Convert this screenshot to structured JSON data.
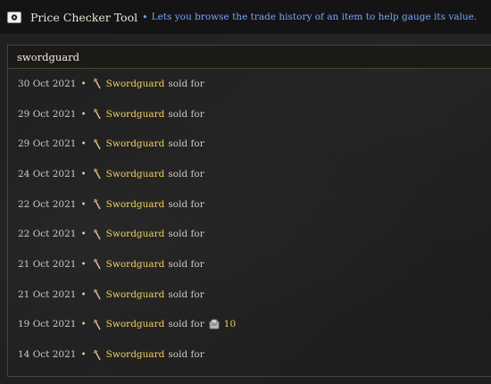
{
  "header": {
    "title": "Price Checker Tool",
    "bullet": "•",
    "subtitle": "Lets you browse the trade history of an item to help gauge its value.",
    "icon": "cash-icon"
  },
  "search": {
    "value": "swordguard"
  },
  "colors": {
    "item_name": "#f0d060",
    "subtitle": "#74a6ff",
    "panel_border": "#4b4538"
  },
  "sales": [
    {
      "date": "30 Oct 2021",
      "sep": "•",
      "item": "Swordguard",
      "sold_text": "sold for",
      "price": ""
    },
    {
      "date": "29 Oct 2021",
      "sep": "•",
      "item": "Swordguard",
      "sold_text": "sold for",
      "price": ""
    },
    {
      "date": "29 Oct 2021",
      "sep": "•",
      "item": "Swordguard",
      "sold_text": "sold for",
      "price": ""
    },
    {
      "date": "24 Oct 2021",
      "sep": "•",
      "item": "Swordguard",
      "sold_text": "sold for",
      "price": ""
    },
    {
      "date": "22 Oct 2021",
      "sep": "•",
      "item": "Swordguard",
      "sold_text": "sold for",
      "price": ""
    },
    {
      "date": "22 Oct 2021",
      "sep": "•",
      "item": "Swordguard",
      "sold_text": "sold for",
      "price": ""
    },
    {
      "date": "21 Oct 2021",
      "sep": "•",
      "item": "Swordguard",
      "sold_text": "sold for",
      "price": ""
    },
    {
      "date": "21 Oct 2021",
      "sep": "•",
      "item": "Swordguard",
      "sold_text": "sold for",
      "price": ""
    },
    {
      "date": "19 Oct 2021",
      "sep": "•",
      "item": "Swordguard",
      "sold_text": "sold for",
      "price": "10"
    },
    {
      "date": "14 Oct 2021",
      "sep": "•",
      "item": "Swordguard",
      "sold_text": "sold for",
      "price": ""
    }
  ]
}
